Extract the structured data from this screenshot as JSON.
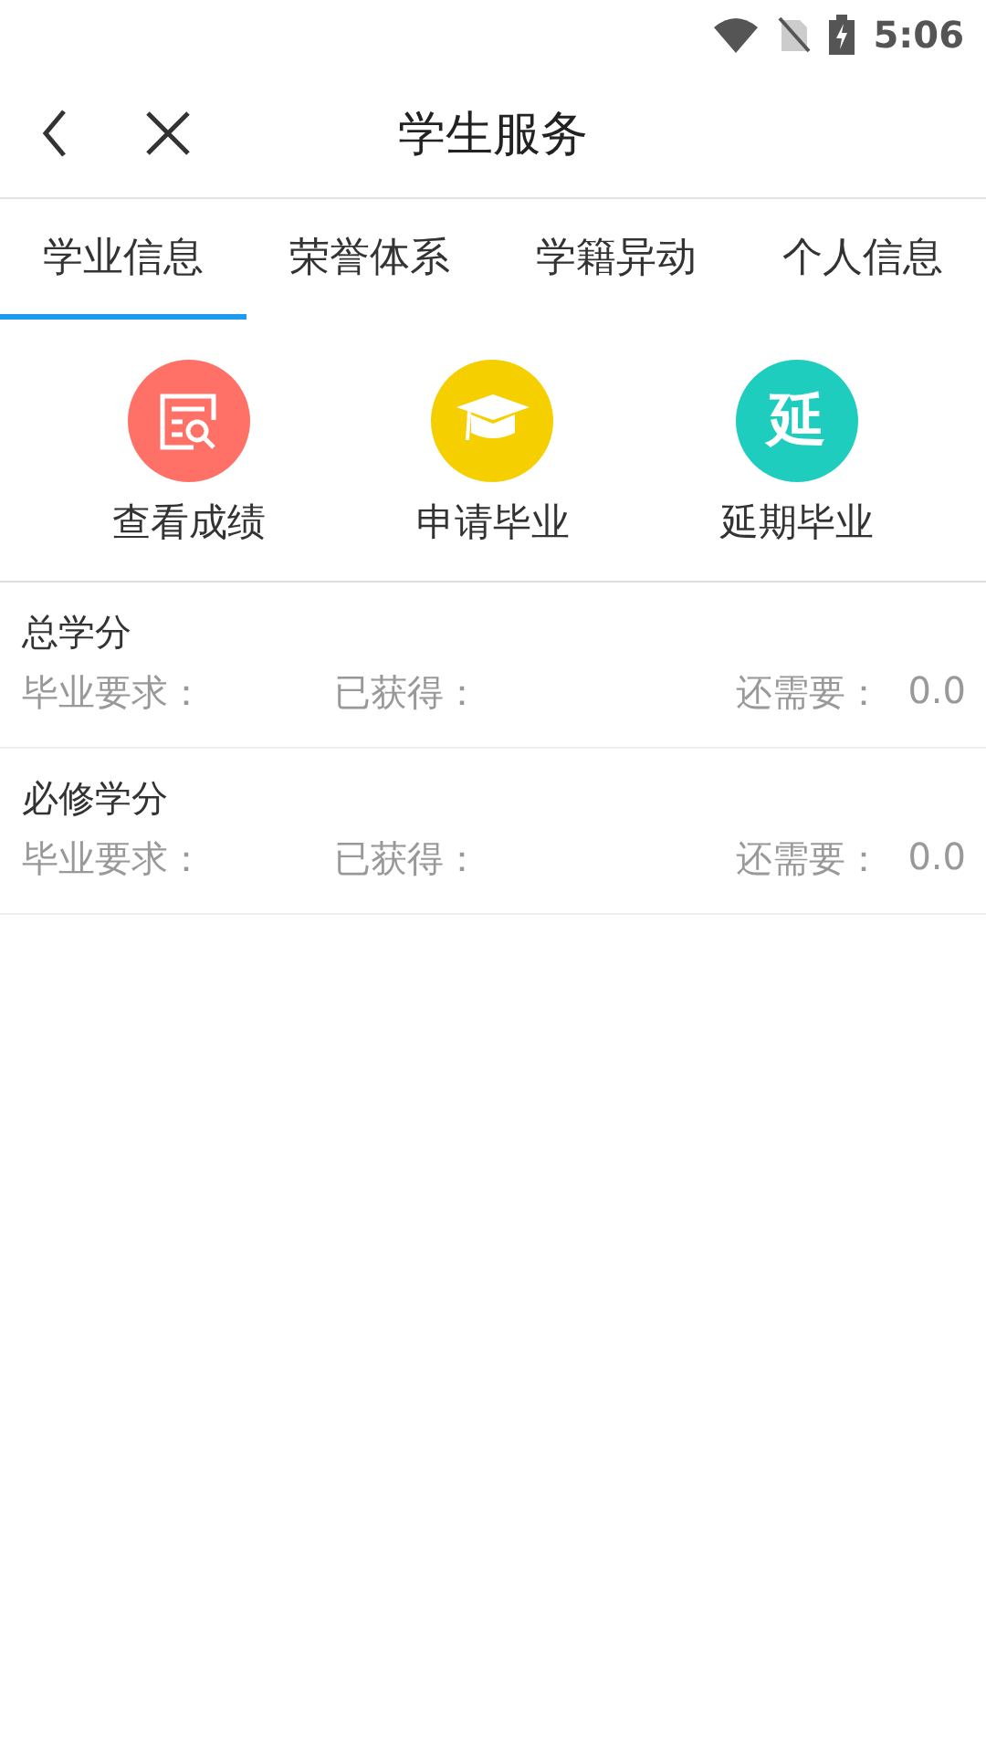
{
  "status_bar": {
    "time": "5:06"
  },
  "header": {
    "title": "学生服务"
  },
  "tabs": [
    {
      "label": "学业信息",
      "selected": true
    },
    {
      "label": "荣誉体系",
      "selected": false
    },
    {
      "label": "学籍异动",
      "selected": false
    },
    {
      "label": "个人信息",
      "selected": false
    }
  ],
  "services": [
    {
      "label": "查看成绩",
      "kind": "search-doc",
      "color": "#ff7066"
    },
    {
      "label": "申请毕业",
      "kind": "cap",
      "color": "#f5cf00"
    },
    {
      "label": "延期毕业",
      "kind": "glyph",
      "glyph": "延",
      "color": "#1fcdbf"
    }
  ],
  "credits": [
    {
      "title": "总学分",
      "fields": [
        {
          "label": "毕业要求："
        },
        {
          "label": "已获得："
        },
        {
          "label": "还需要：",
          "value": "0.0"
        }
      ]
    },
    {
      "title": "必修学分",
      "fields": [
        {
          "label": "毕业要求："
        },
        {
          "label": "已获得："
        },
        {
          "label": "还需要：",
          "value": "0.0"
        }
      ]
    }
  ]
}
